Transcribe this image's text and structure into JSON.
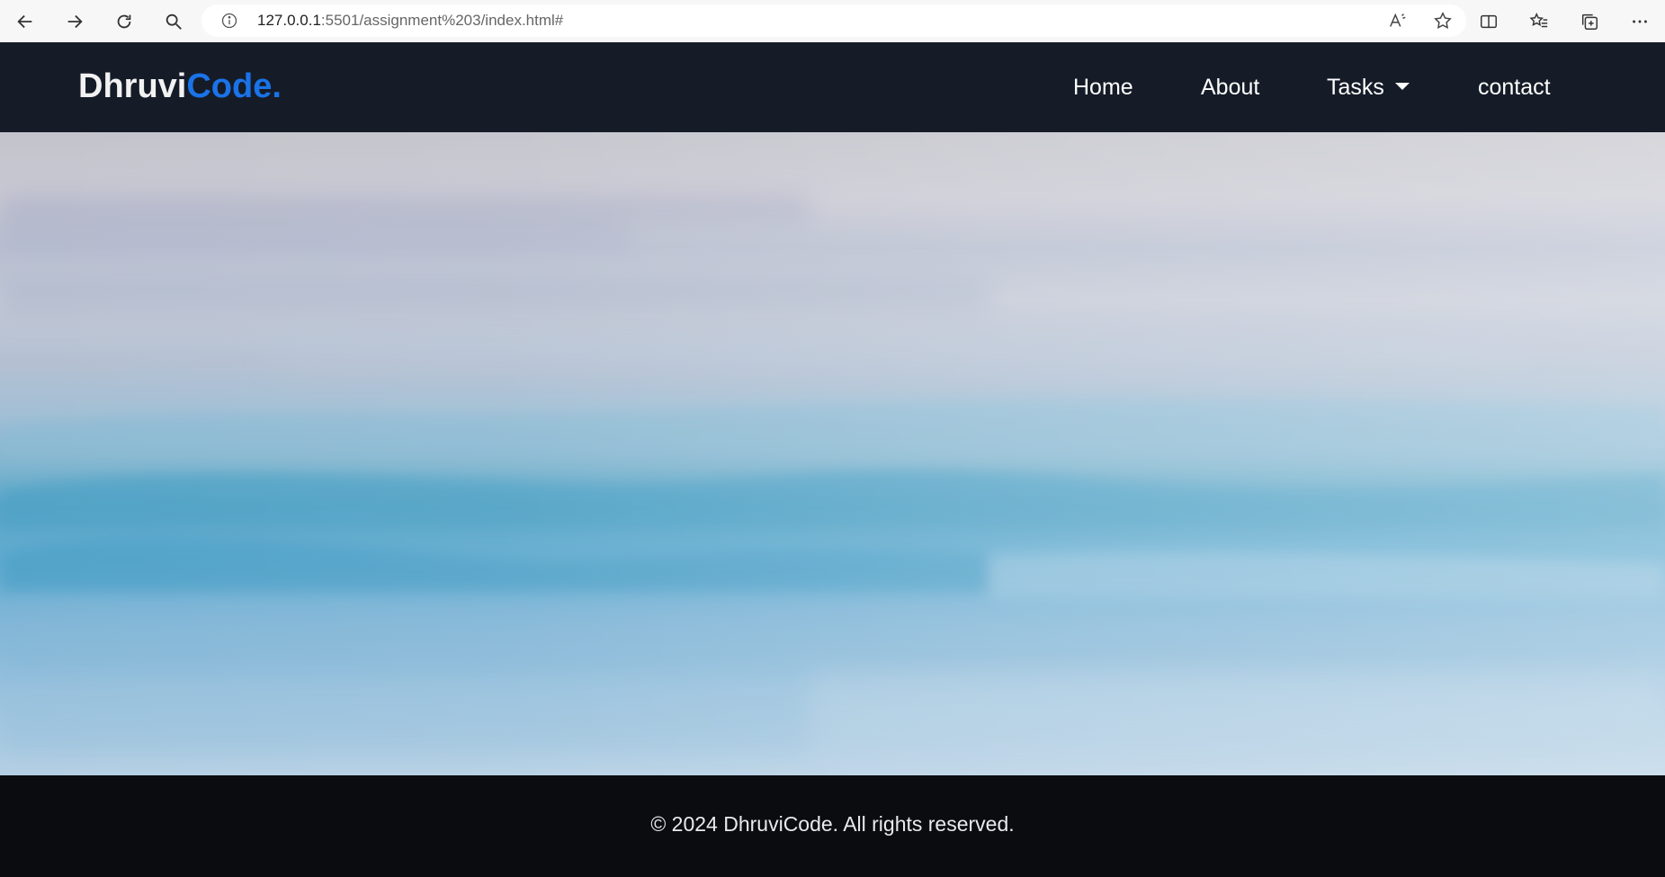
{
  "browser": {
    "url_host": "127.0.0.1",
    "url_rest": ":5501/assignment%203/index.html#",
    "icons": [
      "back-icon",
      "forward-icon",
      "refresh-icon",
      "search-icon",
      "site-info-icon",
      "read-aloud-icon",
      "favorite-star-icon",
      "split-screen-icon",
      "favorites-icon",
      "collections-icon",
      "more-icon"
    ]
  },
  "header": {
    "logo_main": "Dhruvi",
    "logo_accent": "Code.",
    "nav": {
      "home": "Home",
      "about": "About",
      "tasks": "Tasks",
      "contact": "contact"
    }
  },
  "footer": {
    "text": "© 2024 DhruviCode. All rights reserved."
  },
  "colors": {
    "header_bg": "#151c28",
    "accent": "#1a73e8",
    "footer_bg": "#0a0c10"
  }
}
